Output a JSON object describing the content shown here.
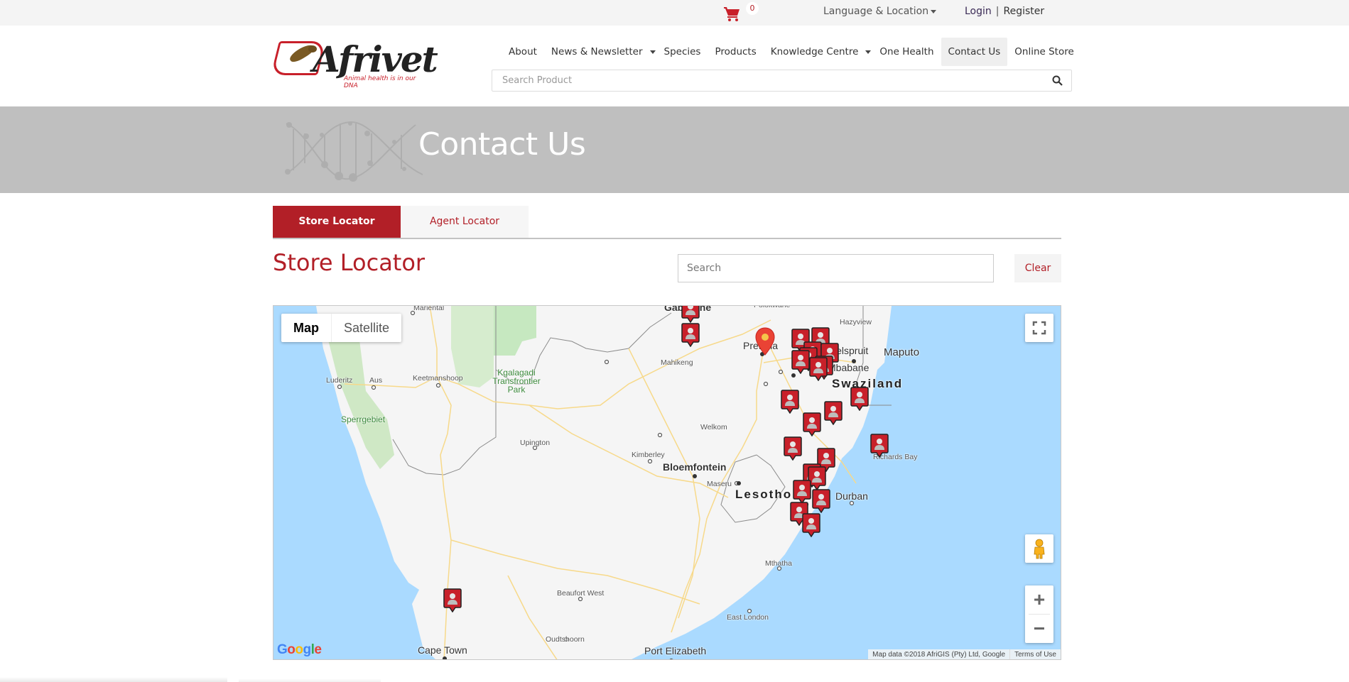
{
  "topbar": {
    "cart_icon": "shopping-cart-icon",
    "cart_count": "0",
    "language_label": "Language & Location",
    "login_label": "Login",
    "separator": "|",
    "register_label": "Register"
  },
  "header": {
    "logo_text": "Afrivet",
    "logo_tagline": "Animal health is in our DNA",
    "nav": [
      {
        "label": "About",
        "dropdown": false,
        "active": false
      },
      {
        "label": "News & Newsletter",
        "dropdown": true,
        "active": false
      },
      {
        "label": "Species",
        "dropdown": false,
        "active": false
      },
      {
        "label": "Products",
        "dropdown": false,
        "active": false
      },
      {
        "label": "Knowledge Centre",
        "dropdown": true,
        "active": false
      },
      {
        "label": "One Health",
        "dropdown": false,
        "active": false
      },
      {
        "label": "Contact Us",
        "dropdown": false,
        "active": true
      },
      {
        "label": "Online Store",
        "dropdown": false,
        "active": false
      }
    ],
    "search_placeholder": "Search Product",
    "search_icon": "search-icon"
  },
  "banner": {
    "title": "Contact Us"
  },
  "tabs": [
    {
      "label": "Store Locator",
      "active": true
    },
    {
      "label": "Agent Locator",
      "active": false
    }
  ],
  "locator": {
    "title": "Store Locator",
    "search_placeholder": "Search",
    "clear_label": "Clear"
  },
  "map": {
    "type_buttons": [
      {
        "label": "Map",
        "active": true
      },
      {
        "label": "Satellite",
        "active": false
      }
    ],
    "zoom_in": "+",
    "zoom_out": "−",
    "google_logo": "Google",
    "attribution": "Map data ©2018 AfriGIS (Pty) Ltd, Google",
    "terms": "Terms of Use",
    "colors": {
      "water": "#aadaff",
      "land": "#f5f5f5",
      "park": "#c6e8c0",
      "road": "#f9d77e",
      "marker": "#c8202a"
    },
    "place_labels": [
      {
        "name": "Mariental",
        "size": "sm"
      },
      {
        "name": "Gaborone",
        "size": "md"
      },
      {
        "name": "Polokwane",
        "size": "sm"
      },
      {
        "name": "Hazyview",
        "size": "sm"
      },
      {
        "name": "Pretoria",
        "size": "md"
      },
      {
        "name": "Nelspruit",
        "size": "md"
      },
      {
        "name": "Maputo",
        "size": "md"
      },
      {
        "name": "Mahikeng",
        "size": "sm"
      },
      {
        "name": "Mbabane",
        "size": "md"
      },
      {
        "name": "Luderitz",
        "size": "sm"
      },
      {
        "name": "Aus",
        "size": "sm"
      },
      {
        "name": "Keetmanshoop",
        "size": "sm"
      },
      {
        "name": "Swaziland",
        "size": "country"
      },
      {
        "name": "Sperrgebiet",
        "size": "park"
      },
      {
        "name": "Kgalagadi Transfrontier Park",
        "size": "park"
      },
      {
        "name": "Welkom",
        "size": "sm"
      },
      {
        "name": "Upington",
        "size": "sm"
      },
      {
        "name": "Kimberley",
        "size": "sm"
      },
      {
        "name": "Bloemfontein",
        "size": "md"
      },
      {
        "name": "Richards Bay",
        "size": "sm"
      },
      {
        "name": "Maseru",
        "size": "sm"
      },
      {
        "name": "Lesotho",
        "size": "country"
      },
      {
        "name": "Durban",
        "size": "md"
      },
      {
        "name": "Mthatha",
        "size": "sm"
      },
      {
        "name": "Beaufort West",
        "size": "sm"
      },
      {
        "name": "East London",
        "size": "sm"
      },
      {
        "name": "Oudtshoorn",
        "size": "sm"
      },
      {
        "name": "Cape Town",
        "size": "md"
      },
      {
        "name": "Port Elizabeth",
        "size": "md"
      }
    ],
    "store_marker_count": 25,
    "current_location_pin": "Pretoria"
  }
}
